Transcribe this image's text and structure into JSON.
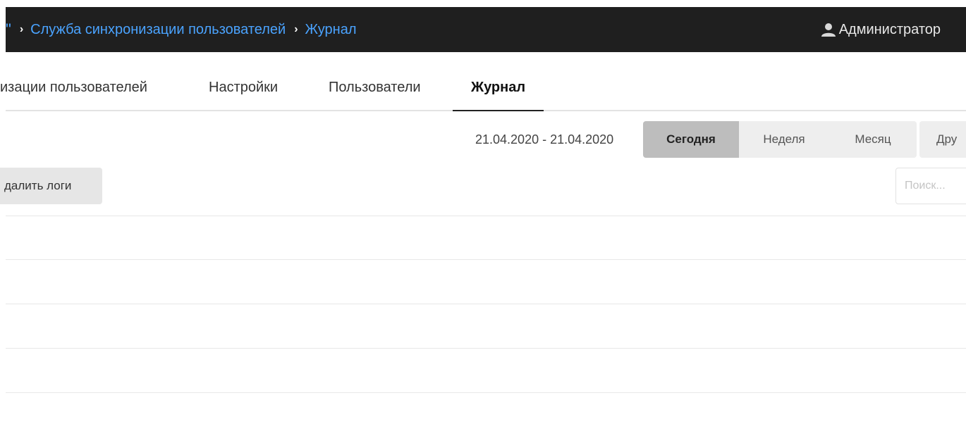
{
  "header": {
    "breadcrumb": {
      "truncated_prefix": "\"",
      "separator": "›",
      "items": [
        {
          "label": "Служба синхронизации пользователей"
        },
        {
          "label": "Журнал"
        }
      ]
    },
    "user": {
      "name": "Администратор",
      "icon": "user-icon"
    }
  },
  "tabs": [
    {
      "label": "изации пользователей",
      "active": false
    },
    {
      "label": "Настройки",
      "active": false
    },
    {
      "label": "Пользователи",
      "active": false
    },
    {
      "label": "Журнал",
      "active": true
    }
  ],
  "filters": {
    "date_range": "21.04.2020 - 21.04.2020",
    "periods": [
      {
        "label": "Сегодня",
        "selected": true
      },
      {
        "label": "Неделя",
        "selected": false
      },
      {
        "label": "Месяц",
        "selected": false
      },
      {
        "label": "Дру",
        "selected": false
      }
    ]
  },
  "actions": {
    "delete_logs_label": "далить логи"
  },
  "search": {
    "placeholder": "Поиск...",
    "value": ""
  },
  "table": {
    "rows": []
  },
  "colors": {
    "header_bg": "#1f1f1f",
    "link": "#4aa3ff",
    "selected_segment": "#bdbdbd",
    "segment": "#eeeeee"
  }
}
